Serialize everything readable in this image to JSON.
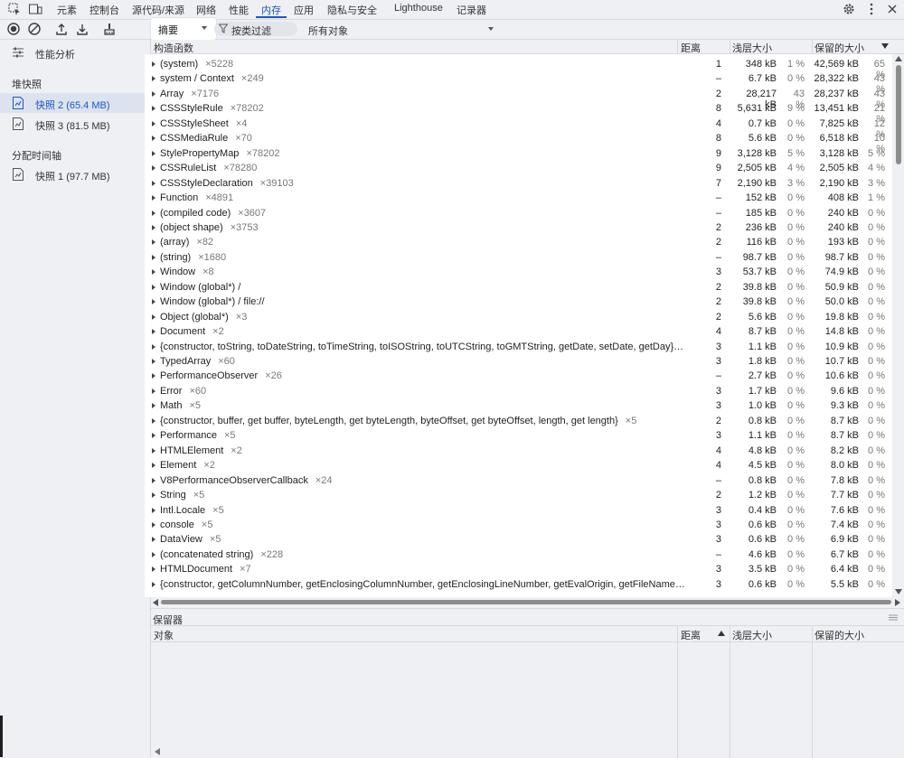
{
  "tabs": [
    "元素",
    "控制台",
    "源代码/来源",
    "网络",
    "性能",
    "内存",
    "应用",
    "隐私与安全",
    "Lighthouse",
    "记录器"
  ],
  "active_tab": "内存",
  "toolbar": {
    "view_select": "摘要",
    "filter_placeholder": "按类过滤",
    "objects_select": "所有对象"
  },
  "sidebar": {
    "profiles_label": "性能分析",
    "heap_header": "堆快照",
    "items": [
      "快照 2 (65.4 MB)",
      "快照 3 (81.5 MB)"
    ],
    "timeline_header": "分配时间轴",
    "timeline_items": [
      "快照 1 (97.7 MB)"
    ]
  },
  "table": {
    "headers": {
      "constructor": "构造函数",
      "distance": "距离",
      "shallow": "浅层大小",
      "retained": "保留的大小"
    },
    "rows": [
      {
        "name": "(system)",
        "count": "×5228",
        "dist": "1",
        "shal": "348 kB",
        "shalp": "1 %",
        "ret": "42,569 kB",
        "retp": "65 %"
      },
      {
        "name": "system / Context",
        "count": "×249",
        "dist": "–",
        "shal": "6.7 kB",
        "shalp": "0 %",
        "ret": "28,322 kB",
        "retp": "43 %"
      },
      {
        "name": "Array",
        "count": "×7176",
        "dist": "2",
        "shal": "28,217 kB",
        "shalp": "43 %",
        "ret": "28,237 kB",
        "retp": "43 %"
      },
      {
        "name": "CSSStyleRule",
        "count": "×78202",
        "dist": "8",
        "shal": "5,631 kB",
        "shalp": "9 %",
        "ret": "13,451 kB",
        "retp": "21 %"
      },
      {
        "name": "CSSStyleSheet",
        "count": "×4",
        "dist": "4",
        "shal": "0.7 kB",
        "shalp": "0 %",
        "ret": "7,825 kB",
        "retp": "12 %"
      },
      {
        "name": "CSSMediaRule",
        "count": "×70",
        "dist": "8",
        "shal": "5.6 kB",
        "shalp": "0 %",
        "ret": "6,518 kB",
        "retp": "10 %"
      },
      {
        "name": "StylePropertyMap",
        "count": "×78202",
        "dist": "9",
        "shal": "3,128 kB",
        "shalp": "5 %",
        "ret": "3,128 kB",
        "retp": "5 %"
      },
      {
        "name": "CSSRuleList",
        "count": "×78280",
        "dist": "9",
        "shal": "2,505 kB",
        "shalp": "4 %",
        "ret": "2,505 kB",
        "retp": "4 %"
      },
      {
        "name": "CSSStyleDeclaration",
        "count": "×39103",
        "dist": "7",
        "shal": "2,190 kB",
        "shalp": "3 %",
        "ret": "2,190 kB",
        "retp": "3 %"
      },
      {
        "name": "Function",
        "count": "×4891",
        "dist": "–",
        "shal": "152 kB",
        "shalp": "0 %",
        "ret": "408 kB",
        "retp": "1 %"
      },
      {
        "name": "(compiled code)",
        "count": "×3607",
        "dist": "–",
        "shal": "185 kB",
        "shalp": "0 %",
        "ret": "240 kB",
        "retp": "0 %"
      },
      {
        "name": "(object shape)",
        "count": "×3753",
        "dist": "2",
        "shal": "236 kB",
        "shalp": "0 %",
        "ret": "240 kB",
        "retp": "0 %"
      },
      {
        "name": "(array)",
        "count": "×82",
        "dist": "2",
        "shal": "116 kB",
        "shalp": "0 %",
        "ret": "193 kB",
        "retp": "0 %"
      },
      {
        "name": "(string)",
        "count": "×1680",
        "dist": "–",
        "shal": "98.7 kB",
        "shalp": "0 %",
        "ret": "98.7 kB",
        "retp": "0 %"
      },
      {
        "name": "Window",
        "count": "×8",
        "dist": "3",
        "shal": "53.7 kB",
        "shalp": "0 %",
        "ret": "74.9 kB",
        "retp": "0 %"
      },
      {
        "name": "Window (global*) /",
        "count": "",
        "dist": "2",
        "shal": "39.8 kB",
        "shalp": "0 %",
        "ret": "50.9 kB",
        "retp": "0 %"
      },
      {
        "name": "Window (global*) / file://",
        "count": "",
        "dist": "2",
        "shal": "39.8 kB",
        "shalp": "0 %",
        "ret": "50.0 kB",
        "retp": "0 %"
      },
      {
        "name": "Object (global*)",
        "count": "×3",
        "dist": "2",
        "shal": "5.6 kB",
        "shalp": "0 %",
        "ret": "19.8 kB",
        "retp": "0 %"
      },
      {
        "name": "Document",
        "count": "×2",
        "dist": "4",
        "shal": "8.7 kB",
        "shalp": "0 %",
        "ret": "14.8 kB",
        "retp": "0 %"
      },
      {
        "name": "{constructor, toString, toDateString, toTimeString, toISOString, toUTCString, toGMTString, getDate, setDate, getDay}…",
        "count": "",
        "dist": "3",
        "shal": "1.1 kB",
        "shalp": "0 %",
        "ret": "10.9 kB",
        "retp": "0 %"
      },
      {
        "name": "TypedArray",
        "count": "×60",
        "dist": "3",
        "shal": "1.8 kB",
        "shalp": "0 %",
        "ret": "10.7 kB",
        "retp": "0 %"
      },
      {
        "name": "PerformanceObserver",
        "count": "×26",
        "dist": "–",
        "shal": "2.7 kB",
        "shalp": "0 %",
        "ret": "10.6 kB",
        "retp": "0 %"
      },
      {
        "name": "Error",
        "count": "×60",
        "dist": "3",
        "shal": "1.7 kB",
        "shalp": "0 %",
        "ret": "9.6 kB",
        "retp": "0 %"
      },
      {
        "name": "Math",
        "count": "×5",
        "dist": "3",
        "shal": "1.0 kB",
        "shalp": "0 %",
        "ret": "9.3 kB",
        "retp": "0 %"
      },
      {
        "name": "{constructor, buffer, get buffer, byteLength, get byteLength, byteOffset, get byteOffset, length, get length}",
        "count": "×5",
        "dist": "2",
        "shal": "0.8 kB",
        "shalp": "0 %",
        "ret": "8.7 kB",
        "retp": "0 %"
      },
      {
        "name": "Performance",
        "count": "×5",
        "dist": "3",
        "shal": "1.1 kB",
        "shalp": "0 %",
        "ret": "8.7 kB",
        "retp": "0 %"
      },
      {
        "name": "HTMLElement",
        "count": "×2",
        "dist": "4",
        "shal": "4.8 kB",
        "shalp": "0 %",
        "ret": "8.2 kB",
        "retp": "0 %"
      },
      {
        "name": "Element",
        "count": "×2",
        "dist": "4",
        "shal": "4.5 kB",
        "shalp": "0 %",
        "ret": "8.0 kB",
        "retp": "0 %"
      },
      {
        "name": "V8PerformanceObserverCallback",
        "count": "×24",
        "dist": "–",
        "shal": "0.8 kB",
        "shalp": "0 %",
        "ret": "7.8 kB",
        "retp": "0 %"
      },
      {
        "name": "String",
        "count": "×5",
        "dist": "2",
        "shal": "1.2 kB",
        "shalp": "0 %",
        "ret": "7.7 kB",
        "retp": "0 %"
      },
      {
        "name": "Intl.Locale",
        "count": "×5",
        "dist": "3",
        "shal": "0.4 kB",
        "shalp": "0 %",
        "ret": "7.6 kB",
        "retp": "0 %"
      },
      {
        "name": "console",
        "count": "×5",
        "dist": "3",
        "shal": "0.6 kB",
        "shalp": "0 %",
        "ret": "7.4 kB",
        "retp": "0 %"
      },
      {
        "name": "DataView",
        "count": "×5",
        "dist": "3",
        "shal": "0.6 kB",
        "shalp": "0 %",
        "ret": "6.9 kB",
        "retp": "0 %"
      },
      {
        "name": "(concatenated string)",
        "count": "×228",
        "dist": "–",
        "shal": "4.6 kB",
        "shalp": "0 %",
        "ret": "6.7 kB",
        "retp": "0 %"
      },
      {
        "name": "HTMLDocument",
        "count": "×7",
        "dist": "3",
        "shal": "3.5 kB",
        "shalp": "0 %",
        "ret": "6.4 kB",
        "retp": "0 %"
      },
      {
        "name": "{constructor, getColumnNumber, getEnclosingColumnNumber, getEnclosingLineNumber, getEvalOrigin, getFileName…",
        "count": "",
        "dist": "3",
        "shal": "0.6 kB",
        "shalp": "0 %",
        "ret": "5.5 kB",
        "retp": "0 %"
      }
    ]
  },
  "retainers": {
    "title": "保留器",
    "headers": {
      "object": "对象",
      "distance": "距离",
      "shallow": "浅层大小",
      "retained": "保留的大小"
    }
  }
}
